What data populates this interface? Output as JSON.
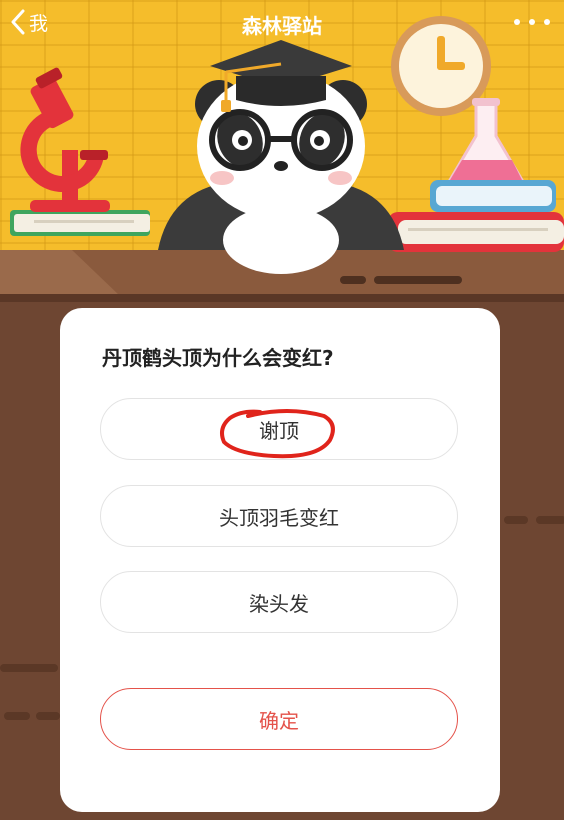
{
  "header": {
    "back_label": "我",
    "title": "森林驿站"
  },
  "quiz": {
    "question": "丹顶鹤头顶为什么会变红?",
    "options": [
      {
        "label": "谢顶",
        "circled": true
      },
      {
        "label": "头顶羽毛变红",
        "circled": false
      },
      {
        "label": "染头发",
        "circled": false
      }
    ],
    "confirm_label": "确定"
  },
  "colors": {
    "accent": "#e4524a",
    "wall": "#f5bd2b",
    "desk": "#6e4632",
    "annotation": "#e0241b"
  },
  "icons": {
    "back": "chevron-left-icon",
    "more": "more-dots-icon"
  }
}
